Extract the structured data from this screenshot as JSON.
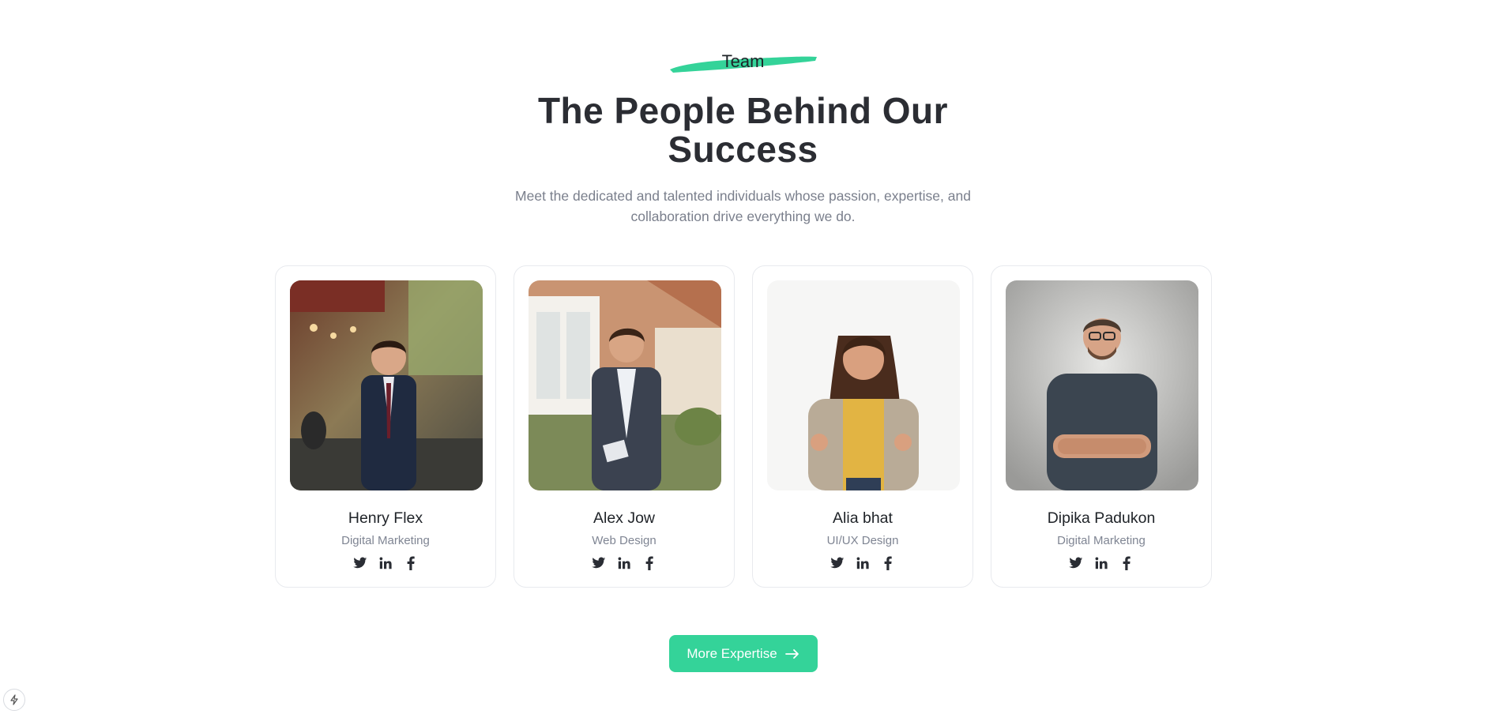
{
  "header": {
    "eyebrow": "Team",
    "title_line1": "The People Behind Our",
    "title_line2": "Success",
    "subtitle_line1": "Meet the dedicated and talented individuals whose passion, expertise, and",
    "subtitle_line2": "collaboration drive everything we do."
  },
  "team": [
    {
      "name": "Henry Flex",
      "role": "Digital Marketing"
    },
    {
      "name": "Alex Jow",
      "role": "Web Design"
    },
    {
      "name": "Alia bhat",
      "role": "UI/UX Design"
    },
    {
      "name": "Dipika Padukon",
      "role": "Digital Marketing"
    }
  ],
  "social_icons": [
    "twitter-icon",
    "linkedin-icon",
    "facebook-icon"
  ],
  "cta": {
    "label": "More Expertise"
  },
  "colors": {
    "accent": "#34d399",
    "heading": "#2b2d33",
    "muted": "#7a7f8c",
    "card_border": "#e8eaee"
  }
}
